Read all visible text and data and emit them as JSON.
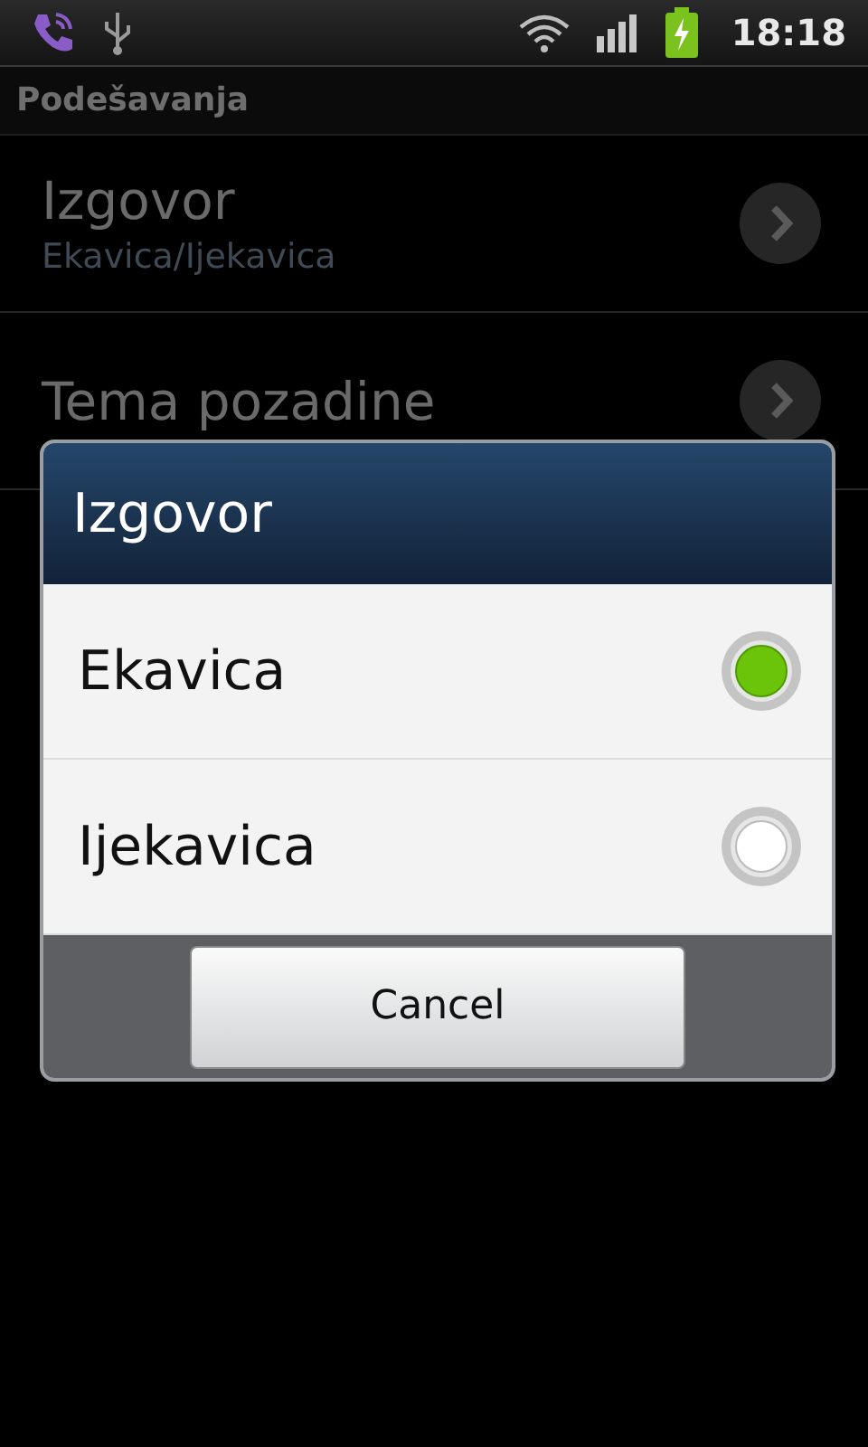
{
  "status_bar": {
    "time": "18:18"
  },
  "title": "Podešavanja",
  "settings": [
    {
      "title": "Izgovor",
      "summary": "Ekavica/Ijekavica"
    },
    {
      "title": "Tema pozadine"
    }
  ],
  "dialog": {
    "title": "Izgovor",
    "options": [
      {
        "label": "Ekavica",
        "selected": true
      },
      {
        "label": "Ijekavica",
        "selected": false
      }
    ],
    "button": "Cancel"
  }
}
